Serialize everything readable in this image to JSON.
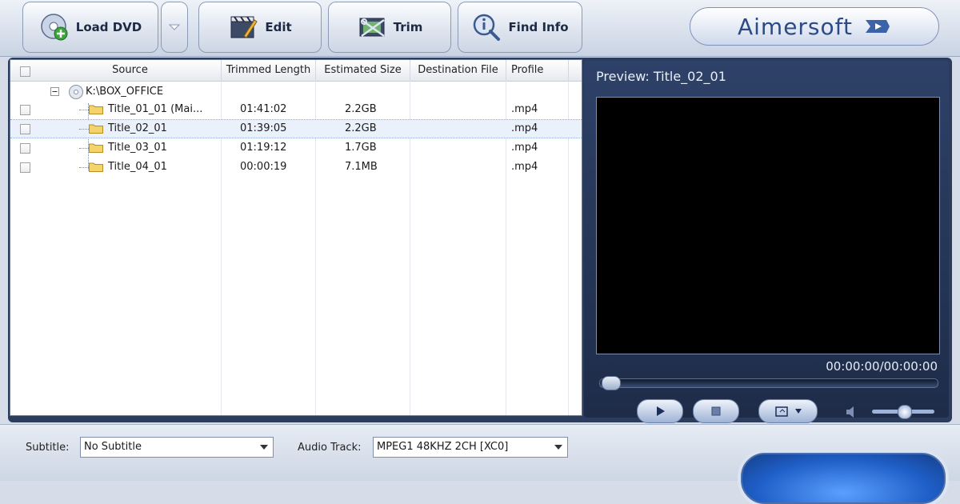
{
  "toolbar": {
    "load_dvd": "Load DVD",
    "edit": "Edit",
    "trim": "Trim",
    "find_info": "Find Info"
  },
  "brand": {
    "name": "Aimersoft"
  },
  "columns": [
    "Source",
    "Trimmed Length",
    "Estimated Size",
    "Destination File",
    "Profile"
  ],
  "tree": {
    "root": "K:\\BOX_OFFICE",
    "rows": [
      {
        "name": "Title_01_01 (Mai...",
        "length": "01:41:02",
        "size": "2.2GB",
        "dest": "",
        "profile": ".mp4",
        "selected": false
      },
      {
        "name": "Title_02_01",
        "length": "01:39:05",
        "size": "2.2GB",
        "dest": "",
        "profile": ".mp4",
        "selected": true
      },
      {
        "name": "Title_03_01",
        "length": "01:19:12",
        "size": "1.7GB",
        "dest": "",
        "profile": ".mp4",
        "selected": false
      },
      {
        "name": "Title_04_01",
        "length": "00:00:19",
        "size": "7.1MB",
        "dest": "",
        "profile": ".mp4",
        "selected": false
      }
    ]
  },
  "preview": {
    "title": "Preview: Title_02_01",
    "timecode": "00:00:00/00:00:00",
    "seek_fraction": 0.0,
    "volume_fraction": 0.5
  },
  "bottom": {
    "subtitle_label": "Subtitle:",
    "subtitle_value": "No Subtitle",
    "audio_label": "Audio Track:",
    "audio_value": "MPEG1 48KHZ 2CH [XC0]"
  },
  "colors": {
    "panel_bg": "#2c3c5c",
    "accent": "#2b4a86",
    "selection": "#eaf1fb"
  }
}
